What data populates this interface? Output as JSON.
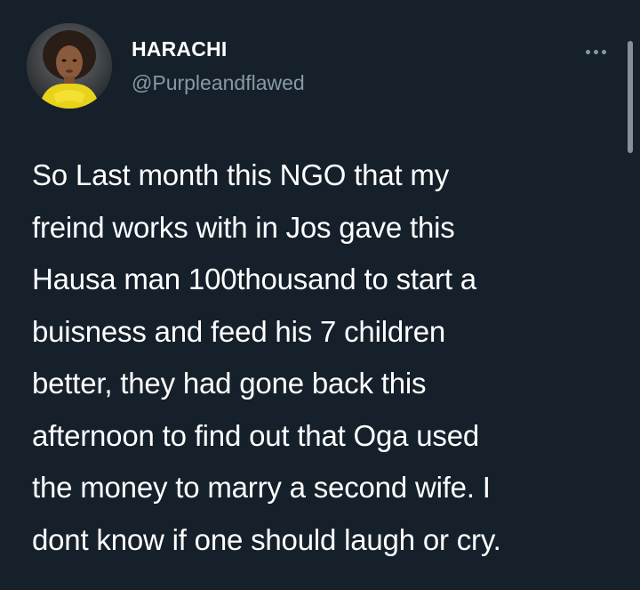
{
  "tweet": {
    "author": {
      "display_name": "HARACHI",
      "handle": "@Purpleandflawed",
      "avatar_icon": "profile-photo"
    },
    "more_icon": "more-horizontal-icon",
    "text_lines": [
      "So Last month this NGO that my",
      "freind works with in Jos gave this",
      "Hausa man 100thousand to start a",
      "buisness and feed his 7 children",
      "better, they had gone back this",
      "afternoon to find out that Oga used",
      "the money to marry a second wife. I",
      "dont know if one should laugh or cry."
    ]
  },
  "colors": {
    "background": "#15202b",
    "text": "#ffffff",
    "secondary_text": "#8899a6"
  }
}
